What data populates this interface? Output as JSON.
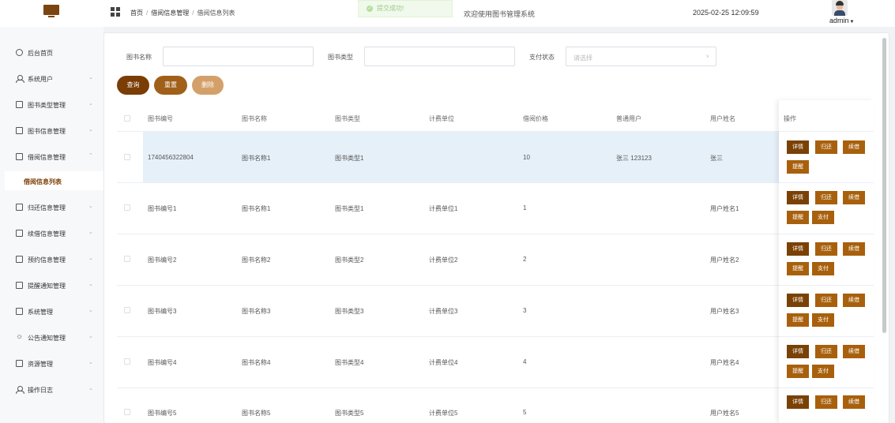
{
  "header": {
    "breadcrumb": [
      "首页",
      "借阅信息管理",
      "借阅信息列表"
    ],
    "toast": "提交成功!",
    "title": "欢迎使用图书管理系统",
    "datetime": "2025-02-25 12:09:59",
    "username": "admin"
  },
  "sidebar": {
    "items": [
      {
        "label": "后台首页",
        "icon": "clock-icon"
      },
      {
        "label": "系统用户",
        "icon": "user-icon"
      },
      {
        "label": "图书类型管理",
        "icon": "menu-icon"
      },
      {
        "label": "图书信息管理",
        "icon": "menu-icon"
      },
      {
        "label": "借阅信息管理",
        "icon": "menu-icon"
      },
      {
        "label": "归还信息管理",
        "icon": "menu-icon"
      },
      {
        "label": "续借信息管理",
        "icon": "menu-icon"
      },
      {
        "label": "预约信息管理",
        "icon": "menu-icon"
      },
      {
        "label": "提醒通知管理",
        "icon": "menu-icon"
      },
      {
        "label": "系统管理",
        "icon": "folder-icon"
      },
      {
        "label": "公告通知管理",
        "icon": "sun-icon"
      },
      {
        "label": "资源管理",
        "icon": "monitor-icon"
      },
      {
        "label": "操作日志",
        "icon": "user-icon"
      }
    ],
    "submenu_active": "借阅信息列表"
  },
  "search": {
    "name_label": "图书名称",
    "type_label": "图书类型",
    "pay_label": "支付状态",
    "pay_placeholder": "请选择",
    "name_value": "",
    "type_value": ""
  },
  "buttons": {
    "query": "查询",
    "reset": "重置",
    "delete": "删除"
  },
  "table": {
    "headers": [
      "图书编号",
      "图书名称",
      "图书类型",
      "计费单位",
      "借阅价格",
      "普通用户",
      "用户姓名",
      "操作"
    ],
    "rows": [
      {
        "book_no": "1740456322804",
        "name": "图书名称1",
        "type": "图书类型1",
        "unit": "",
        "price": "10",
        "user": "张三 123123",
        "realname": "张三",
        "actions": [
          "详情",
          "归还",
          "续借",
          "提醒"
        ]
      },
      {
        "book_no": "图书编号1",
        "name": "图书名称1",
        "type": "图书类型1",
        "unit": "计费单位1",
        "price": "1",
        "user": "",
        "realname": "用户姓名1",
        "actions": [
          "详情",
          "归还",
          "续借",
          "提醒",
          "支付"
        ]
      },
      {
        "book_no": "图书编号2",
        "name": "图书名称2",
        "type": "图书类型2",
        "unit": "计费单位2",
        "price": "2",
        "user": "",
        "realname": "用户姓名2",
        "actions": [
          "详情",
          "归还",
          "续借",
          "提醒",
          "支付"
        ]
      },
      {
        "book_no": "图书编号3",
        "name": "图书名称3",
        "type": "图书类型3",
        "unit": "计费单位3",
        "price": "3",
        "user": "",
        "realname": "用户姓名3",
        "actions": [
          "详情",
          "归还",
          "续借",
          "提醒",
          "支付"
        ]
      },
      {
        "book_no": "图书编号4",
        "name": "图书名称4",
        "type": "图书类型4",
        "unit": "计费单位4",
        "price": "4",
        "user": "",
        "realname": "用户姓名4",
        "actions": [
          "详情",
          "归还",
          "续借",
          "提醒",
          "支付"
        ]
      },
      {
        "book_no": "图书编号5",
        "name": "图书名称5",
        "type": "图书类型5",
        "unit": "计费单位5",
        "price": "5",
        "user": "",
        "realname": "用户姓名5",
        "actions": [
          "详情",
          "归还",
          "续借"
        ]
      }
    ]
  },
  "colors": {
    "primary": "#7a3d05",
    "secondary": "#a0601a",
    "disabled": "#d4a06a",
    "action": "#a8600c"
  }
}
